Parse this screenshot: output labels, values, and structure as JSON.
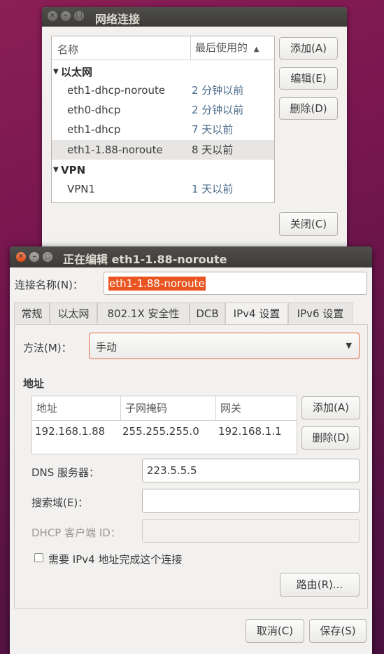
{
  "network_window": {
    "title": "网络连接",
    "columns": {
      "name": "名称",
      "last_used": "最后使用的"
    },
    "sort_icon": "triangle-up-icon",
    "groups": [
      {
        "label": "以太网",
        "rows": [
          {
            "name": "eth1-dhcp-noroute",
            "last_used": "2 分钟以前"
          },
          {
            "name": "eth0-dhcp",
            "last_used": "2 分钟以前"
          },
          {
            "name": "eth1-dhcp",
            "last_used": "7 天以前"
          },
          {
            "name": "eth1-1.88-noroute",
            "last_used": "8 天以前"
          }
        ]
      },
      {
        "label": "VPN",
        "rows": [
          {
            "name": "VPN1",
            "last_used": "1 天以前"
          }
        ]
      }
    ],
    "buttons": {
      "add": "添加(A)",
      "edit": "编辑(E)",
      "delete": "删除(D)",
      "close": "关闭(C)"
    }
  },
  "edit_window": {
    "title": "正在编辑 eth1-1.88-noroute",
    "connection_name_label": "连接名称(N)：",
    "connection_name_value": "eth1-1.88-noroute",
    "tabs": [
      "常规",
      "以太网",
      "802.1X 安全性",
      "DCB",
      "IPv4 设置",
      "IPv6 设置"
    ],
    "active_tab": "IPv4 设置",
    "method_label": "方法(M)：",
    "method_value": "手动",
    "address_section": "地址",
    "address_columns": {
      "address": "地址",
      "netmask": "子网掩码",
      "gateway": "网关"
    },
    "address_rows": [
      {
        "address": "192.168.1.88",
        "netmask": "255.255.255.0",
        "gateway": "192.168.1.1"
      }
    ],
    "address_buttons": {
      "add": "添加(A)",
      "delete": "删除(D)"
    },
    "dns_label": "DNS 服务器：",
    "dns_value": "223.5.5.5",
    "search_label": "搜索域(E)：",
    "search_value": "",
    "dhcp_label": "DHCP 客户端 ID：",
    "dhcp_value": "",
    "require_ipv4_label": "需要 IPv4 地址完成这个连接",
    "require_ipv4_checked": false,
    "routes_button": "路由(R)...",
    "cancel_button": "取消(C)",
    "save_button": "保存(S)"
  },
  "colors": {
    "accent": "#e95420",
    "titlebar": "#3c3b37",
    "window": "#f2f1f0"
  }
}
